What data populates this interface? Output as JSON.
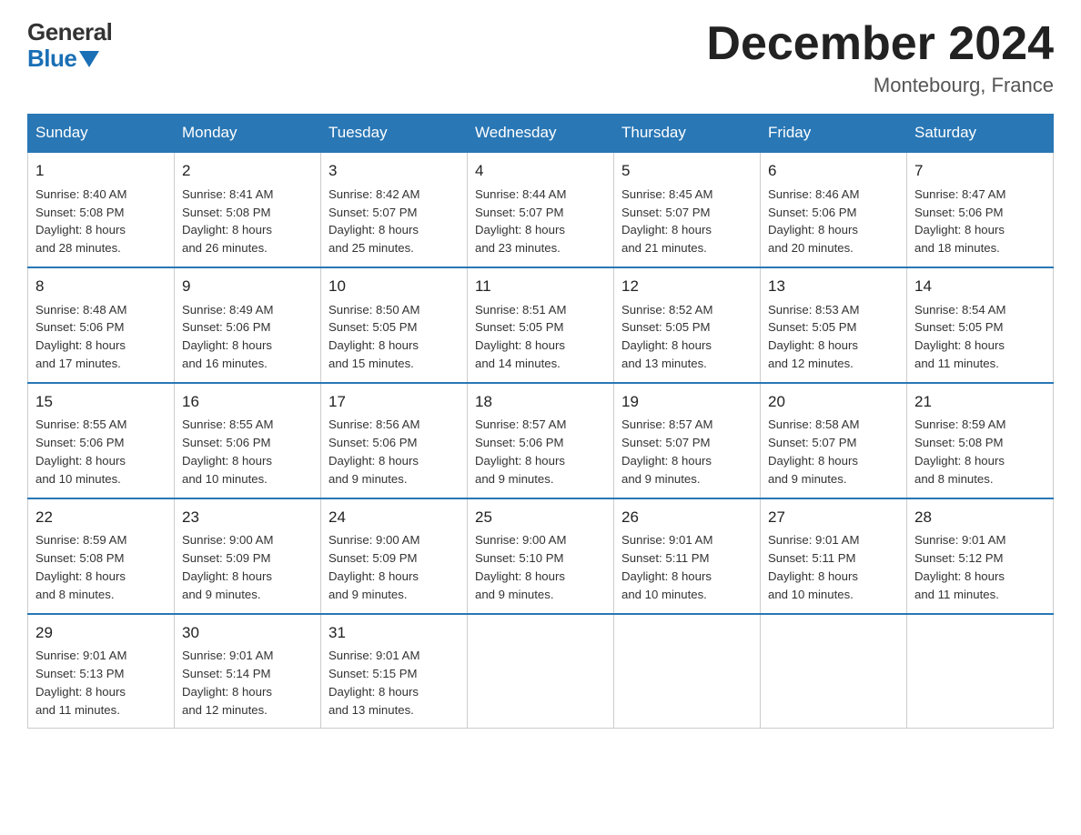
{
  "header": {
    "logo": {
      "general": "General",
      "blue": "Blue",
      "arrow": "▶"
    },
    "title": "December 2024",
    "location": "Montebourg, France"
  },
  "calendar": {
    "days_of_week": [
      "Sunday",
      "Monday",
      "Tuesday",
      "Wednesday",
      "Thursday",
      "Friday",
      "Saturday"
    ],
    "weeks": [
      [
        {
          "day": "1",
          "sunrise": "Sunrise: 8:40 AM",
          "sunset": "Sunset: 5:08 PM",
          "daylight": "Daylight: 8 hours",
          "daylight2": "and 28 minutes."
        },
        {
          "day": "2",
          "sunrise": "Sunrise: 8:41 AM",
          "sunset": "Sunset: 5:08 PM",
          "daylight": "Daylight: 8 hours",
          "daylight2": "and 26 minutes."
        },
        {
          "day": "3",
          "sunrise": "Sunrise: 8:42 AM",
          "sunset": "Sunset: 5:07 PM",
          "daylight": "Daylight: 8 hours",
          "daylight2": "and 25 minutes."
        },
        {
          "day": "4",
          "sunrise": "Sunrise: 8:44 AM",
          "sunset": "Sunset: 5:07 PM",
          "daylight": "Daylight: 8 hours",
          "daylight2": "and 23 minutes."
        },
        {
          "day": "5",
          "sunrise": "Sunrise: 8:45 AM",
          "sunset": "Sunset: 5:07 PM",
          "daylight": "Daylight: 8 hours",
          "daylight2": "and 21 minutes."
        },
        {
          "day": "6",
          "sunrise": "Sunrise: 8:46 AM",
          "sunset": "Sunset: 5:06 PM",
          "daylight": "Daylight: 8 hours",
          "daylight2": "and 20 minutes."
        },
        {
          "day": "7",
          "sunrise": "Sunrise: 8:47 AM",
          "sunset": "Sunset: 5:06 PM",
          "daylight": "Daylight: 8 hours",
          "daylight2": "and 18 minutes."
        }
      ],
      [
        {
          "day": "8",
          "sunrise": "Sunrise: 8:48 AM",
          "sunset": "Sunset: 5:06 PM",
          "daylight": "Daylight: 8 hours",
          "daylight2": "and 17 minutes."
        },
        {
          "day": "9",
          "sunrise": "Sunrise: 8:49 AM",
          "sunset": "Sunset: 5:06 PM",
          "daylight": "Daylight: 8 hours",
          "daylight2": "and 16 minutes."
        },
        {
          "day": "10",
          "sunrise": "Sunrise: 8:50 AM",
          "sunset": "Sunset: 5:05 PM",
          "daylight": "Daylight: 8 hours",
          "daylight2": "and 15 minutes."
        },
        {
          "day": "11",
          "sunrise": "Sunrise: 8:51 AM",
          "sunset": "Sunset: 5:05 PM",
          "daylight": "Daylight: 8 hours",
          "daylight2": "and 14 minutes."
        },
        {
          "day": "12",
          "sunrise": "Sunrise: 8:52 AM",
          "sunset": "Sunset: 5:05 PM",
          "daylight": "Daylight: 8 hours",
          "daylight2": "and 13 minutes."
        },
        {
          "day": "13",
          "sunrise": "Sunrise: 8:53 AM",
          "sunset": "Sunset: 5:05 PM",
          "daylight": "Daylight: 8 hours",
          "daylight2": "and 12 minutes."
        },
        {
          "day": "14",
          "sunrise": "Sunrise: 8:54 AM",
          "sunset": "Sunset: 5:05 PM",
          "daylight": "Daylight: 8 hours",
          "daylight2": "and 11 minutes."
        }
      ],
      [
        {
          "day": "15",
          "sunrise": "Sunrise: 8:55 AM",
          "sunset": "Sunset: 5:06 PM",
          "daylight": "Daylight: 8 hours",
          "daylight2": "and 10 minutes."
        },
        {
          "day": "16",
          "sunrise": "Sunrise: 8:55 AM",
          "sunset": "Sunset: 5:06 PM",
          "daylight": "Daylight: 8 hours",
          "daylight2": "and 10 minutes."
        },
        {
          "day": "17",
          "sunrise": "Sunrise: 8:56 AM",
          "sunset": "Sunset: 5:06 PM",
          "daylight": "Daylight: 8 hours",
          "daylight2": "and 9 minutes."
        },
        {
          "day": "18",
          "sunrise": "Sunrise: 8:57 AM",
          "sunset": "Sunset: 5:06 PM",
          "daylight": "Daylight: 8 hours",
          "daylight2": "and 9 minutes."
        },
        {
          "day": "19",
          "sunrise": "Sunrise: 8:57 AM",
          "sunset": "Sunset: 5:07 PM",
          "daylight": "Daylight: 8 hours",
          "daylight2": "and 9 minutes."
        },
        {
          "day": "20",
          "sunrise": "Sunrise: 8:58 AM",
          "sunset": "Sunset: 5:07 PM",
          "daylight": "Daylight: 8 hours",
          "daylight2": "and 9 minutes."
        },
        {
          "day": "21",
          "sunrise": "Sunrise: 8:59 AM",
          "sunset": "Sunset: 5:08 PM",
          "daylight": "Daylight: 8 hours",
          "daylight2": "and 8 minutes."
        }
      ],
      [
        {
          "day": "22",
          "sunrise": "Sunrise: 8:59 AM",
          "sunset": "Sunset: 5:08 PM",
          "daylight": "Daylight: 8 hours",
          "daylight2": "and 8 minutes."
        },
        {
          "day": "23",
          "sunrise": "Sunrise: 9:00 AM",
          "sunset": "Sunset: 5:09 PM",
          "daylight": "Daylight: 8 hours",
          "daylight2": "and 9 minutes."
        },
        {
          "day": "24",
          "sunrise": "Sunrise: 9:00 AM",
          "sunset": "Sunset: 5:09 PM",
          "daylight": "Daylight: 8 hours",
          "daylight2": "and 9 minutes."
        },
        {
          "day": "25",
          "sunrise": "Sunrise: 9:00 AM",
          "sunset": "Sunset: 5:10 PM",
          "daylight": "Daylight: 8 hours",
          "daylight2": "and 9 minutes."
        },
        {
          "day": "26",
          "sunrise": "Sunrise: 9:01 AM",
          "sunset": "Sunset: 5:11 PM",
          "daylight": "Daylight: 8 hours",
          "daylight2": "and 10 minutes."
        },
        {
          "day": "27",
          "sunrise": "Sunrise: 9:01 AM",
          "sunset": "Sunset: 5:11 PM",
          "daylight": "Daylight: 8 hours",
          "daylight2": "and 10 minutes."
        },
        {
          "day": "28",
          "sunrise": "Sunrise: 9:01 AM",
          "sunset": "Sunset: 5:12 PM",
          "daylight": "Daylight: 8 hours",
          "daylight2": "and 11 minutes."
        }
      ],
      [
        {
          "day": "29",
          "sunrise": "Sunrise: 9:01 AM",
          "sunset": "Sunset: 5:13 PM",
          "daylight": "Daylight: 8 hours",
          "daylight2": "and 11 minutes."
        },
        {
          "day": "30",
          "sunrise": "Sunrise: 9:01 AM",
          "sunset": "Sunset: 5:14 PM",
          "daylight": "Daylight: 8 hours",
          "daylight2": "and 12 minutes."
        },
        {
          "day": "31",
          "sunrise": "Sunrise: 9:01 AM",
          "sunset": "Sunset: 5:15 PM",
          "daylight": "Daylight: 8 hours",
          "daylight2": "and 13 minutes."
        },
        null,
        null,
        null,
        null
      ]
    ]
  }
}
